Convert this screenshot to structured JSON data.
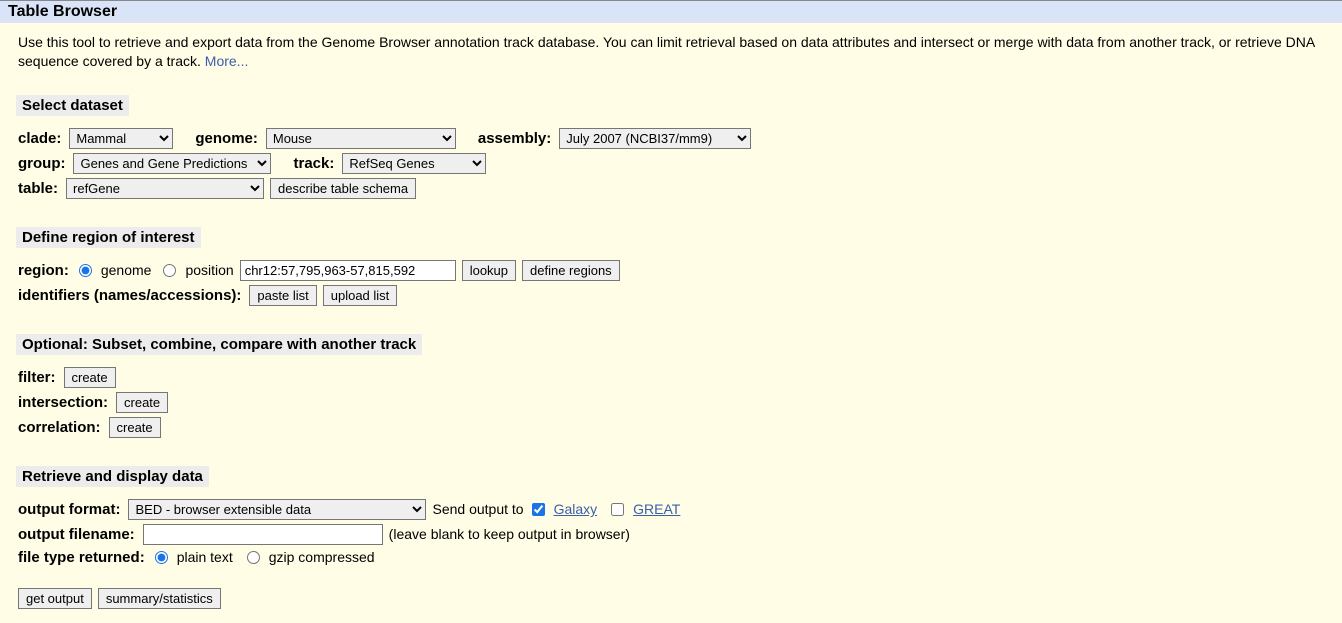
{
  "header": {
    "title": "Table Browser"
  },
  "intro": {
    "text": "Use this tool to retrieve and export data from the Genome Browser annotation track database. You can limit retrieval based on data attributes and intersect or merge with data from another track, or retrieve DNA sequence covered by a track. ",
    "more": "More..."
  },
  "sections": {
    "select_dataset": "Select dataset",
    "region": "Define region of interest",
    "optional": "Optional: Subset, combine, compare with another track",
    "retrieve": "Retrieve and display data"
  },
  "labels": {
    "clade": "clade:",
    "genome": "genome:",
    "assembly": "assembly:",
    "group": "group:",
    "track": "track:",
    "table": "table:",
    "region": "region:",
    "genome_radio": "genome",
    "position_radio": "position",
    "identifiers": "identifiers (names/accessions):",
    "filter": "filter:",
    "intersection": "intersection:",
    "correlation": "correlation:",
    "output_format": "output format:",
    "send_output": "Send output to",
    "galaxy": "Galaxy",
    "great": "GREAT",
    "output_filename": "output filename:",
    "filename_hint": "(leave blank to keep output in browser)",
    "file_type": "file type returned:",
    "plain_text": "plain text",
    "gzip": "gzip compressed"
  },
  "buttons": {
    "describe": "describe table schema",
    "lookup": "lookup",
    "define_regions": "define regions",
    "paste_list": "paste list",
    "upload_list": "upload list",
    "create": "create",
    "get_output": "get output",
    "summary": "summary/statistics"
  },
  "values": {
    "clade": "Mammal",
    "genome": "Mouse",
    "assembly": "July 2007 (NCBI37/mm9)",
    "group": "Genes and Gene Predictions",
    "track": "RefSeq Genes",
    "table": "refGene",
    "position": "chr12:57,795,963-57,815,592",
    "output_format": "BED - browser extensible data",
    "output_filename": ""
  }
}
